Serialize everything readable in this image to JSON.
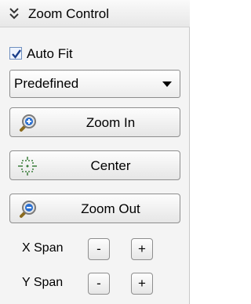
{
  "header": {
    "title": "Zoom Control",
    "icon": "double-chevron-down-icon"
  },
  "auto_fit": {
    "label": "Auto Fit",
    "checked": true
  },
  "select": {
    "value": "Predefined"
  },
  "buttons": {
    "zoom_in": "Zoom In",
    "center": "Center",
    "zoom_out": "Zoom Out"
  },
  "x_span": {
    "label": "X Span",
    "minus": "-",
    "plus": "+"
  },
  "y_span": {
    "label": "Y Span",
    "minus": "-",
    "plus": "+"
  },
  "colors": {
    "icon_blue": "#2a6fd0",
    "lens": "#d8d8d8",
    "handle": "#8a6a1e"
  }
}
